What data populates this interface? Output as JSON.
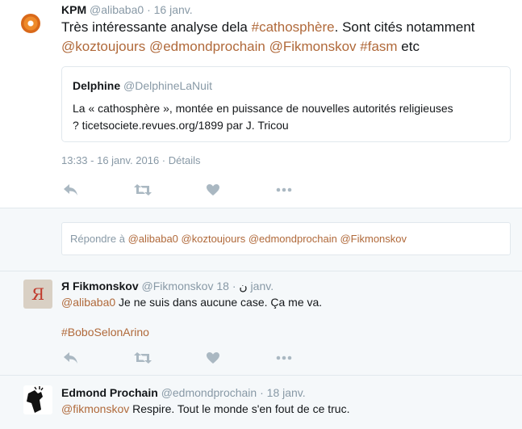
{
  "tweet1": {
    "name": "KPM",
    "handle": "@alibaba0",
    "date_sep": "·",
    "date": "16 janv.",
    "text_plain_1": "Très intéressante analyse dela ",
    "hashtag_1": "#cathosphère",
    "text_plain_2": ". Sont cités notamment",
    "mentions": [
      "@koztoujours",
      "@edmondprochain",
      "@Fikmonskov"
    ],
    "hashtag_2": "#fasm",
    "text_plain_3": " etc",
    "quote": {
      "name": "Delphine",
      "handle": "@DelphineLaNuit",
      "line1": "La « cathosphère », montée en puissance de nouvelles autorités religieuses",
      "line2": "? ticetsociete.revues.org/1899 par J. Tricou"
    },
    "timestamp": "13:33 - 16 janv. 2016",
    "details_sep": " · ",
    "details": "Détails"
  },
  "reply_box": {
    "prefix": "Répondre à ",
    "recipients": "@alibaba0 @koztoujours @edmondprochain @Fikmonskov"
  },
  "tweet2": {
    "name": "Я Fikmonskov",
    "handle": "@Fikmonskov",
    "handle_suffix": "ن",
    "date_sep": "·",
    "date": "18 janv.",
    "mention": "@alibaba0",
    "text": " Je ne suis dans aucune case. Ça me va.",
    "hashtag": "#BoboSelonArino",
    "avatar_letter": "Я"
  },
  "tweet3": {
    "name": "Edmond Prochain",
    "handle": "@edmondprochain",
    "date_sep": "·",
    "date": "18 janv.",
    "mention": "@fikmonskov",
    "text": " Respire. Tout le monde s'en fout de ce truc."
  },
  "icons": {
    "reply": "reply-icon",
    "retweet": "retweet-icon",
    "like": "heart-icon",
    "more": "more-icon"
  },
  "colors": {
    "link": "#b0693a",
    "muted": "#8899a6",
    "border": "#e1e8ed",
    "reply_bg": "#f5f8fa"
  }
}
